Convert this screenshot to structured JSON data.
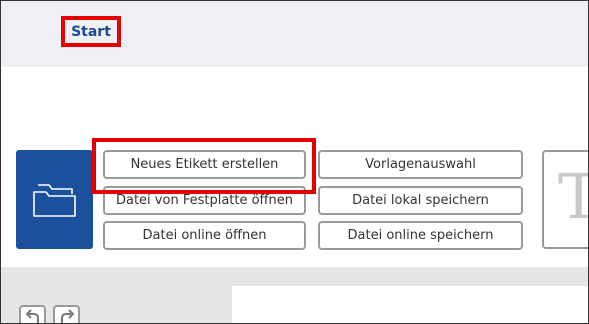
{
  "topbar": {
    "tab_start": "Start"
  },
  "ribbon": {
    "open_folder_icon": "folder-icon",
    "buttons": {
      "new_label": "Neues Etikett erstellen",
      "open_disk": "Datei von Festplatte öffnen",
      "open_online": "Datei online öffnen",
      "templates": "Vorlagenauswahl",
      "save_local": "Datei lokal speichern",
      "save_online": "Datei online speichern"
    },
    "text_tool_glyph": "T"
  },
  "workspace": {
    "undo_icon": "undo-icon",
    "redo_icon": "redo-icon"
  },
  "colors": {
    "accent": "#1c4f9c",
    "highlight": "#e30000",
    "tab_text": "#1a4b99"
  }
}
